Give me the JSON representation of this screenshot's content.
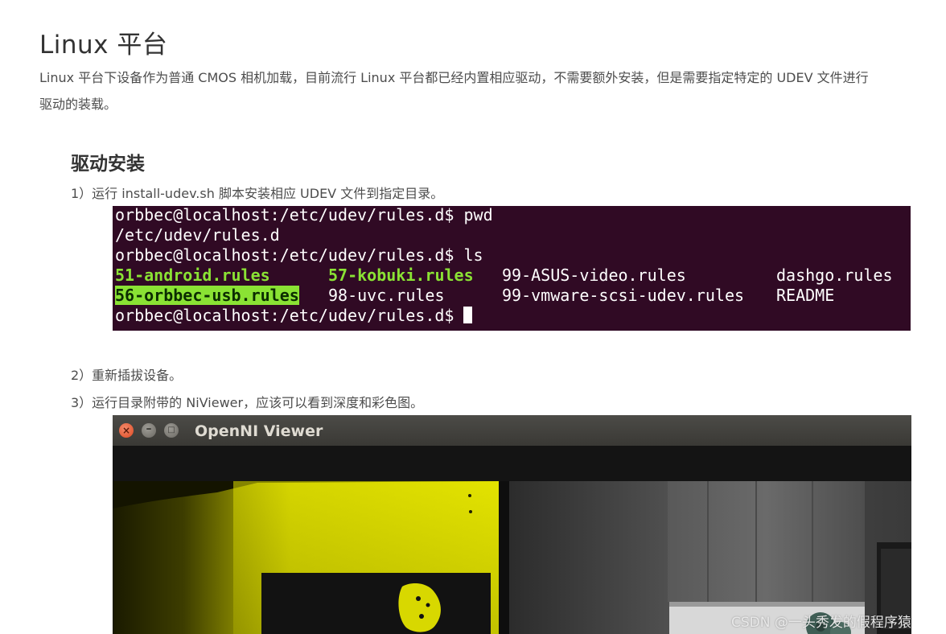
{
  "heading": "Linux 平台",
  "intro": {
    "line1": "Linux 平台下设备作为普通 CMOS 相机加载，目前流行 Linux 平台都已经内置相应驱动，不需要额外安装，但是需要指定特定的 UDEV 文件进行",
    "line2": "驱动的装载。"
  },
  "subheading": "驱动安装",
  "steps": {
    "s1": "1）运行 install-udev.sh 脚本安装相应 UDEV 文件到指定目录。",
    "s2": "2）重新插拔设备。",
    "s3": "3）运行目录附带的 NiViewer，应该可以看到深度和彩色图。"
  },
  "terminal": {
    "prompt1": "orbbec@localhost:/etc/udev/rules.d$ ",
    "cmd1": "pwd",
    "out1": "/etc/udev/rules.d",
    "prompt2": "orbbec@localhost:/etc/udev/rules.d$ ",
    "cmd2": "ls",
    "row1": {
      "c1": "51-android.rules",
      "c2": "57-kobuki.rules",
      "c3": "99-ASUS-video.rules",
      "c4": "dashgo.rules"
    },
    "row2": {
      "c1": "56-orbbec-usb.rules",
      "c2": "98-uvc.rules",
      "c3": "99-vmware-scsi-udev.rules",
      "c4": "README"
    },
    "prompt3": "orbbec@localhost:/etc/udev/rules.d$ ",
    "colors": {
      "background": "#300a24",
      "green": "#8ae234",
      "text": "#ffffff"
    }
  },
  "viewer": {
    "title": "OpenNI Viewer",
    "close_glyph": "×",
    "min_glyph": "–",
    "max_glyph": "□"
  },
  "watermark": "CSDN @一头秀发的假程序猿"
}
